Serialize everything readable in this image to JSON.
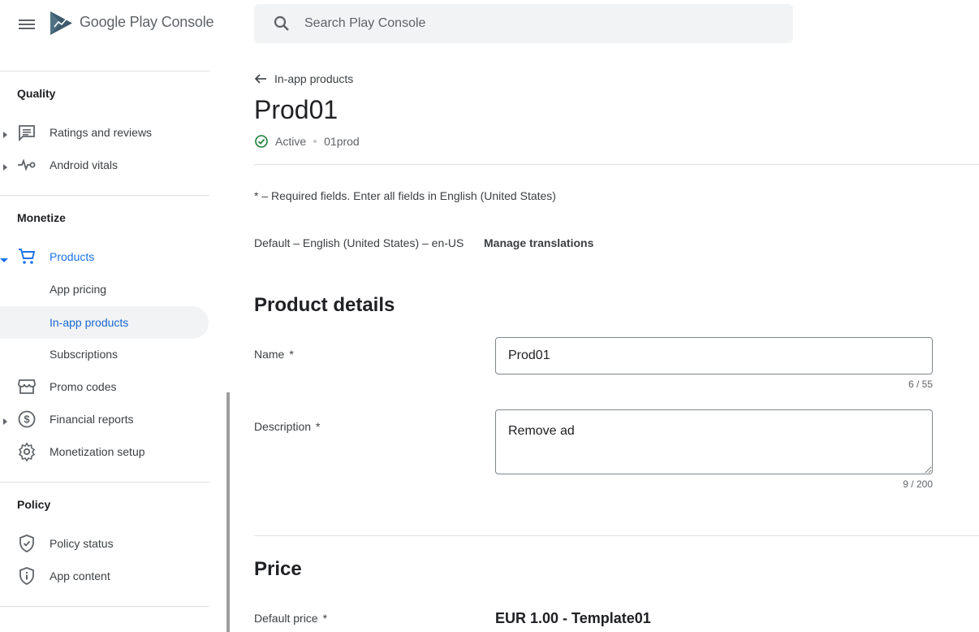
{
  "app": {
    "brand_google_play": "Google Play",
    "brand_console": "Console"
  },
  "search": {
    "placeholder": "Search Play Console"
  },
  "sidebar": {
    "sections": {
      "quality": "Quality",
      "monetize": "Monetize",
      "policy": "Policy"
    },
    "items": {
      "ratings": "Ratings and reviews",
      "vitals": "Android vitals",
      "products": "Products",
      "app_pricing": "App pricing",
      "in_app_products": "In-app products",
      "subscriptions": "Subscriptions",
      "promo_codes": "Promo codes",
      "financial_reports": "Financial reports",
      "monetization_setup": "Monetization setup",
      "policy_status": "Policy status",
      "app_content": "App content"
    }
  },
  "main": {
    "back_label": "In-app products",
    "title": "Prod01",
    "status": "Active",
    "product_id": "01prod",
    "required_note": "* – Required fields. Enter all fields in English (United States)",
    "language": "Default – English (United States) – en-US",
    "manage_translations": "Manage translations",
    "product_details_heading": "Product details",
    "name_label": "Name",
    "name_value": "Prod01",
    "name_counter": "6 / 55",
    "description_label": "Description",
    "description_value": "Remove ad",
    "description_counter": "9 / 200",
    "price_heading": "Price",
    "default_price_label": "Default price",
    "default_price_value": "EUR 1.00 - Template01",
    "required_star": "*"
  },
  "colors": {
    "accent": "#1a73e8",
    "active_green": "#188038",
    "selected_bg": "#f1f3f4"
  }
}
